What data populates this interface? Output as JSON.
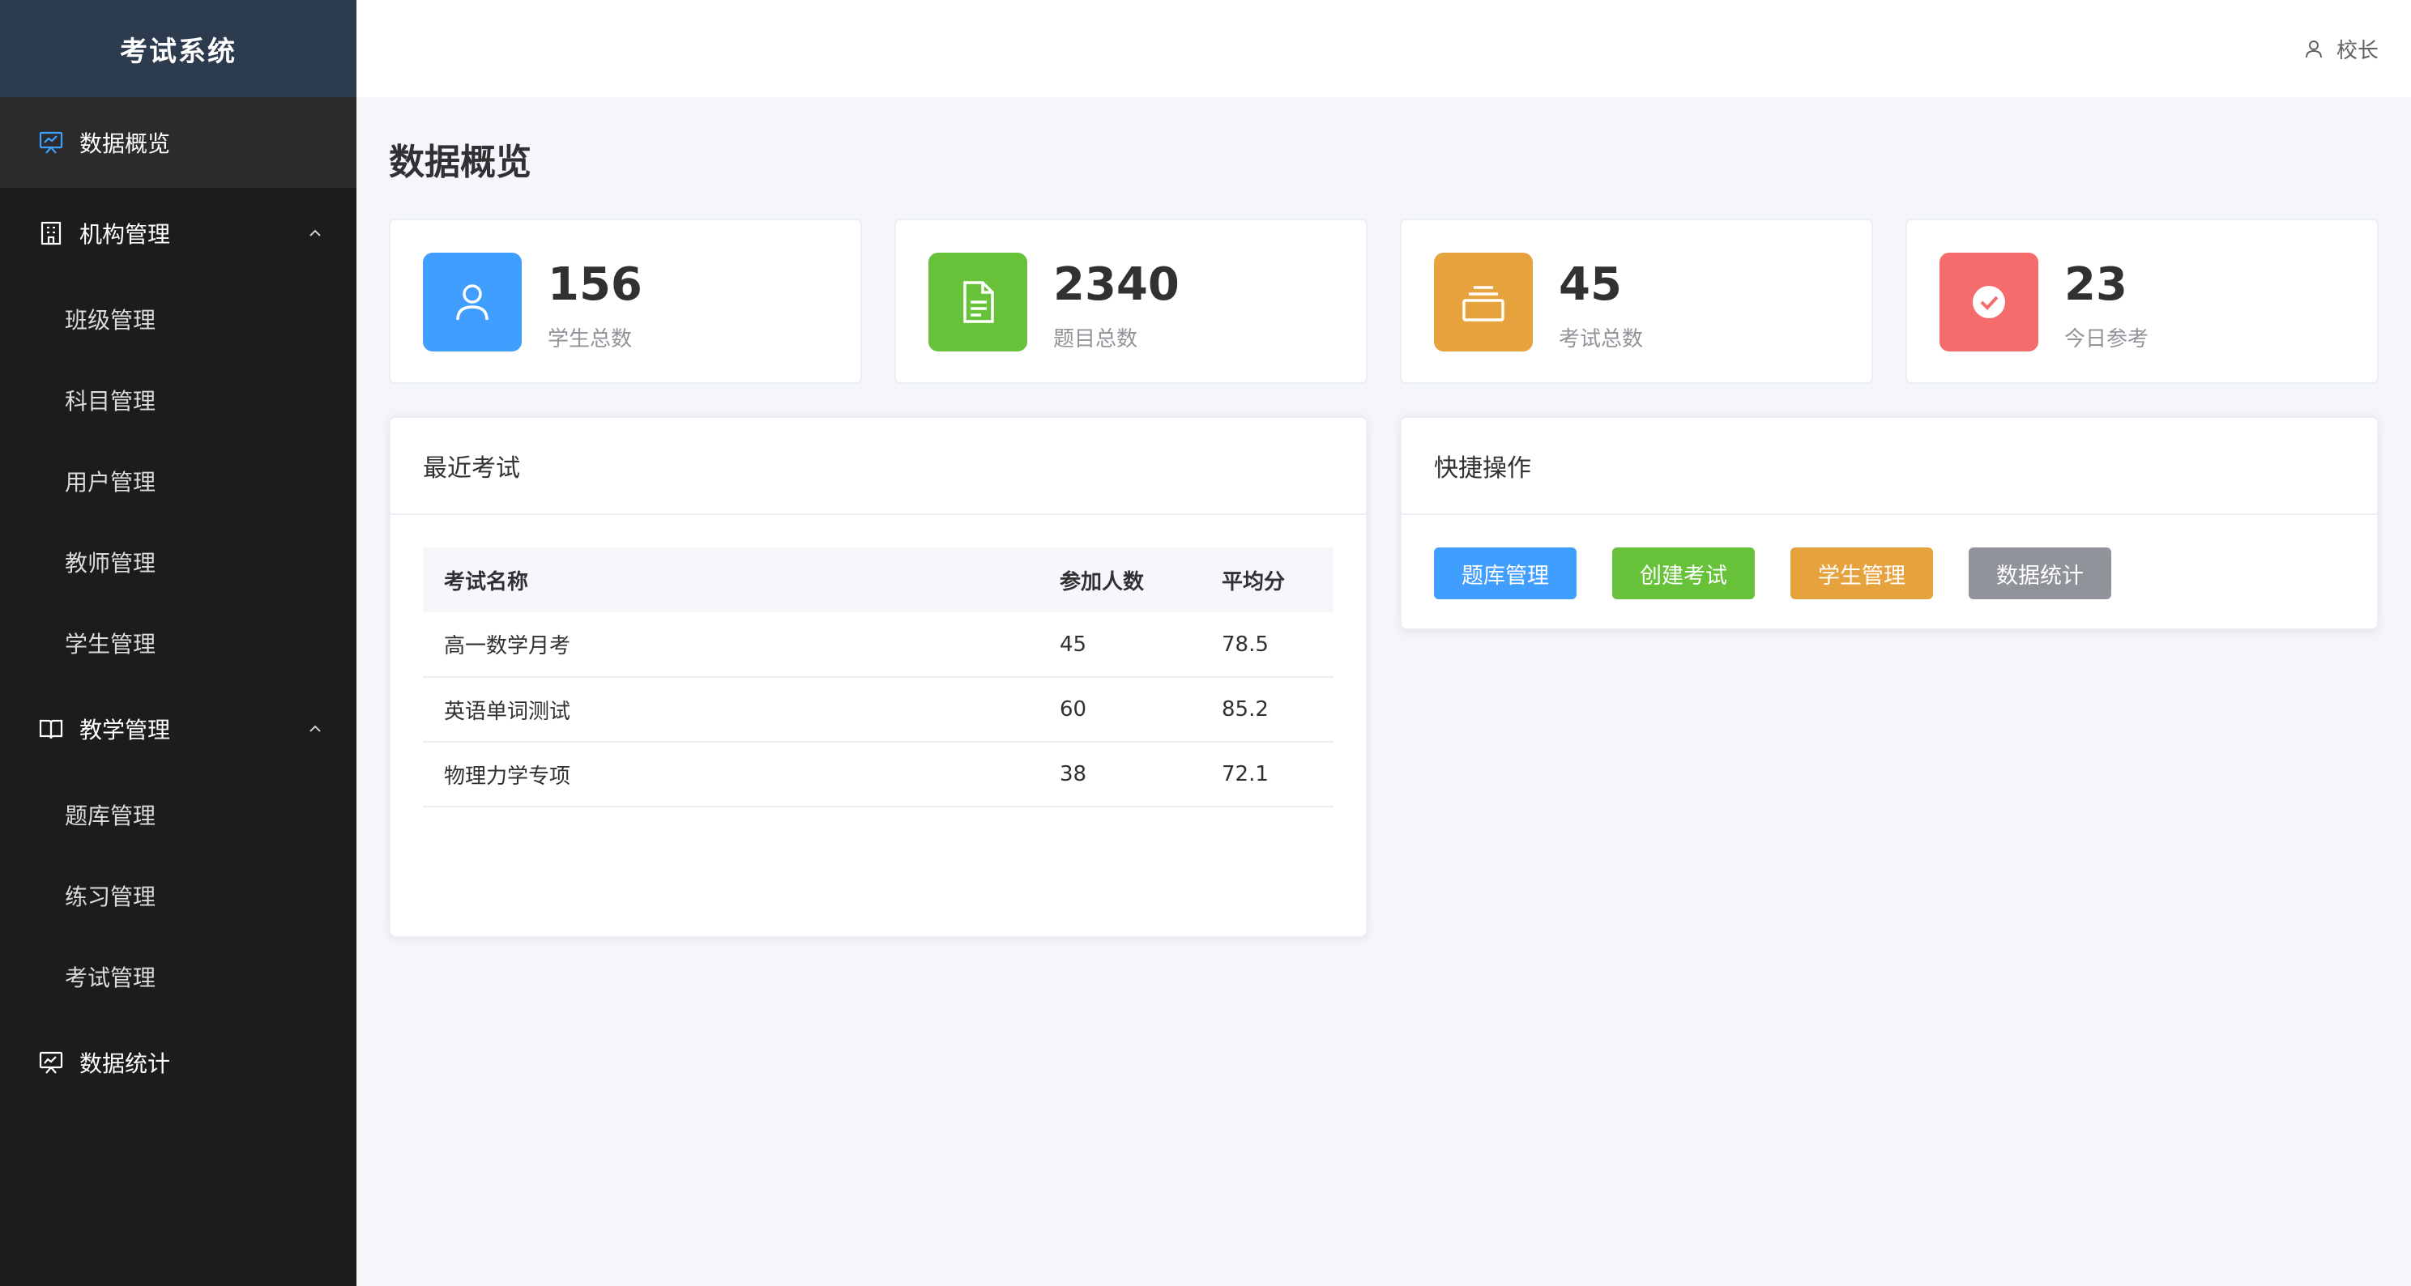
{
  "app": {
    "title": "考试系统"
  },
  "sidebar": {
    "dashboard": {
      "label": "数据概览",
      "icon": "presentation-chart-icon"
    },
    "org": {
      "label": "机构管理",
      "icon": "building-icon",
      "items": [
        "班级管理",
        "科目管理",
        "用户管理",
        "教师管理",
        "学生管理"
      ]
    },
    "teaching": {
      "label": "教学管理",
      "icon": "open-book-icon",
      "items": [
        "题库管理",
        "练习管理",
        "考试管理"
      ]
    },
    "stats": {
      "label": "数据统计",
      "icon": "chart-board-icon"
    }
  },
  "header": {
    "user": "校长"
  },
  "page": {
    "title": "数据概览"
  },
  "stats": [
    {
      "value": "156",
      "label": "学生总数",
      "color": "#409eff",
      "icon": "user-icon"
    },
    {
      "value": "2340",
      "label": "题目总数",
      "color": "#67c23a",
      "icon": "document-icon"
    },
    {
      "value": "45",
      "label": "考试总数",
      "color": "#e6a23c",
      "icon": "stack-icon"
    },
    {
      "value": "23",
      "label": "今日参考",
      "color": "#f56c6c",
      "icon": "check-circle-icon"
    }
  ],
  "recent": {
    "title": "最近考试",
    "columns": [
      "考试名称",
      "参加人数",
      "平均分"
    ],
    "rows": [
      [
        "高一数学月考",
        "45",
        "78.5"
      ],
      [
        "英语单词测试",
        "60",
        "85.2"
      ],
      [
        "物理力学专项",
        "38",
        "72.1"
      ]
    ]
  },
  "quick": {
    "title": "快捷操作",
    "buttons": [
      {
        "label": "题库管理",
        "color": "#409eff"
      },
      {
        "label": "创建考试",
        "color": "#67c23a"
      },
      {
        "label": "学生管理",
        "color": "#e6a23c"
      },
      {
        "label": "数据统计",
        "color": "#909399"
      }
    ]
  }
}
